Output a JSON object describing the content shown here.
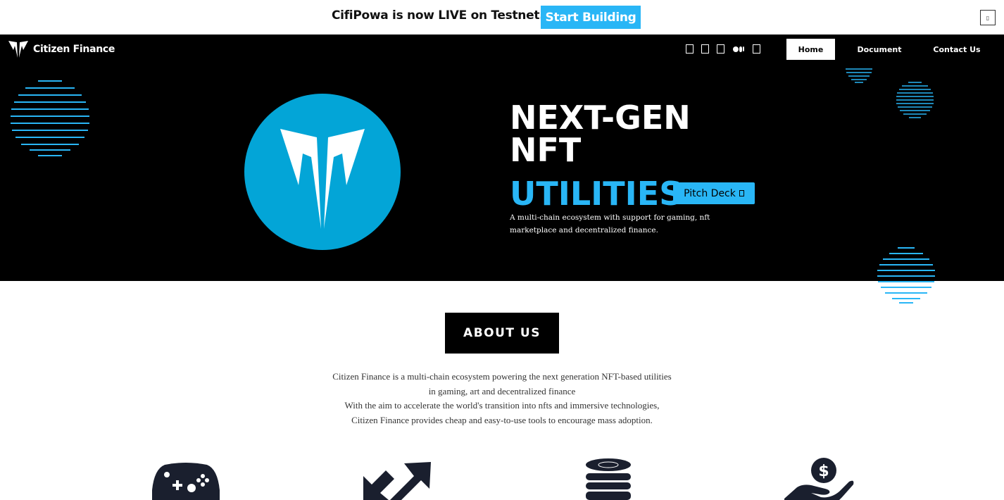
{
  "announcement": {
    "text": "CifiPowa is now LIVE on Testnet.",
    "button_label": "Start Building",
    "close_icon": "close-icon"
  },
  "nav": {
    "brand": "Citizen Finance",
    "socials": [
      "twitter-icon",
      "telegram-icon",
      "discord-icon",
      "medium-icon",
      "github-icon"
    ],
    "links": [
      {
        "label": "Home",
        "active": true
      },
      {
        "label": "Document",
        "active": false
      },
      {
        "label": "Contact Us",
        "active": false
      }
    ]
  },
  "hero": {
    "title_line1": "NEXT-GEN",
    "title_line2": "NFT",
    "title_accent": "UTILITIES",
    "pitch_label": "Pitch Deck",
    "description": "A multi-chain ecosystem with support for gaming, nft marketplace and decentralized finance."
  },
  "about": {
    "heading": "ABOUT US",
    "lines": [
      "Citizen Finance is a multi-chain ecosystem powering the next generation NFT-based utilities",
      "in gaming, art and decentralized finance",
      "With the aim to accelerate the world's transition into nfts and immersive technologies,",
      "Citizen Finance provides cheap and easy-to-use tools to encourage mass adoption."
    ]
  },
  "features": [
    "gamepad-icon",
    "exchange-arrows-icon",
    "coin-stack-icon",
    "money-hand-icon"
  ],
  "colors": {
    "accent": "#29b6f6",
    "logo_circle": "#03a5d7",
    "dark": "#000000"
  }
}
